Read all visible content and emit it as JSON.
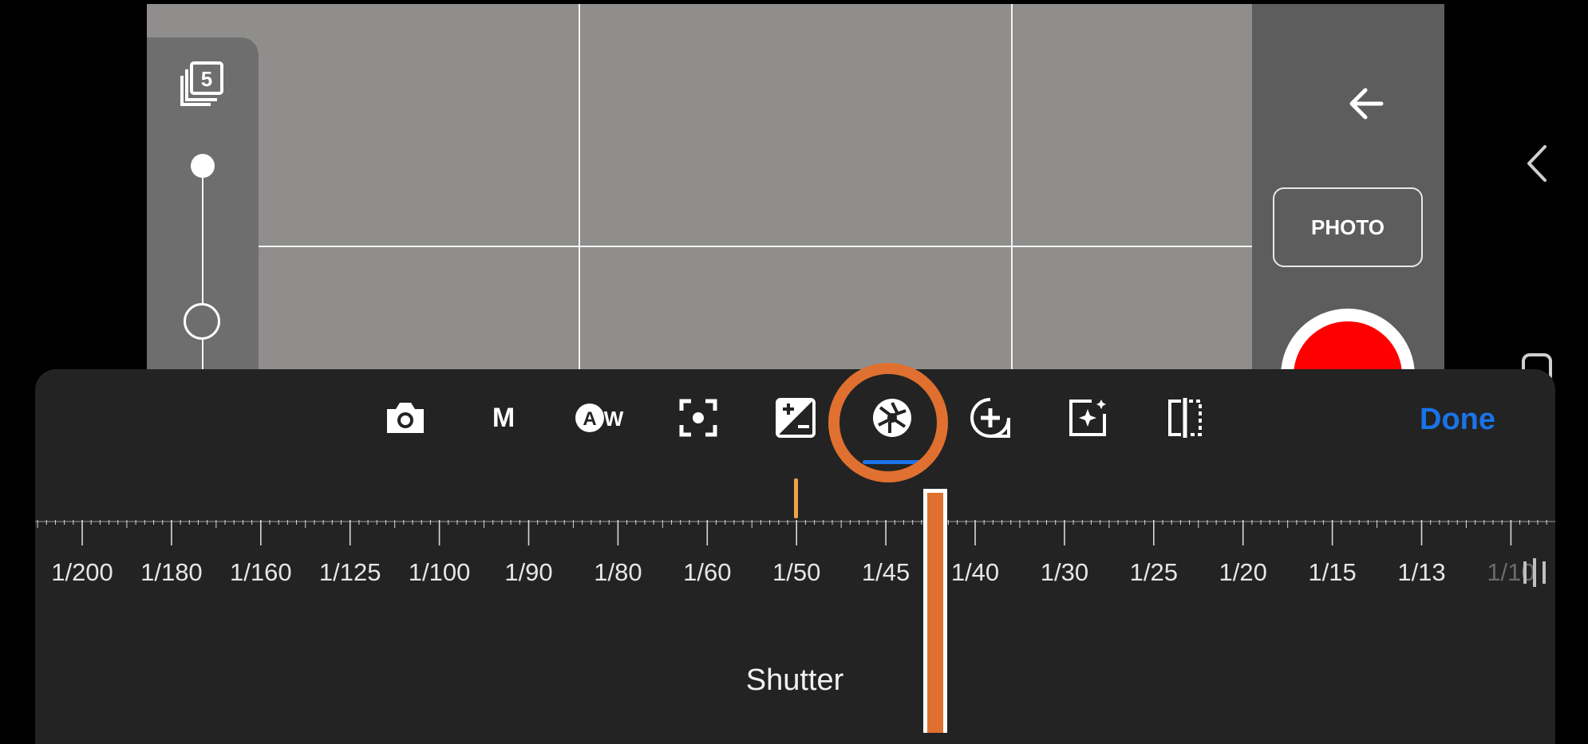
{
  "app": {
    "capture_mode_label": "PHOTO",
    "burst_count": "5"
  },
  "toolbar": {
    "items": [
      {
        "name": "camera-mode-icon",
        "label": ""
      },
      {
        "name": "manual-mode",
        "label": "M"
      },
      {
        "name": "auto-white-balance",
        "label": "AW"
      },
      {
        "name": "focus-icon",
        "label": ""
      },
      {
        "name": "exposure-compensation-icon",
        "label": ""
      },
      {
        "name": "shutter-speed-icon",
        "label": "",
        "selected": true
      },
      {
        "name": "iso-icon",
        "label": ""
      },
      {
        "name": "effects-icon",
        "label": ""
      },
      {
        "name": "split-icon",
        "label": ""
      }
    ],
    "done_label": "Done",
    "accent_color": "#1a73e8"
  },
  "shutter_scale": {
    "ticks": [
      "1/200",
      "1/180",
      "1/160",
      "1/125",
      "1/100",
      "1/90",
      "1/80",
      "1/60",
      "1/50",
      "1/45",
      "1/40",
      "1/30",
      "1/25",
      "1/20",
      "1/15",
      "1/13",
      "1/10"
    ],
    "reference_marker": "1/50",
    "selected_value": "between 1/45 and 1/40",
    "marker_color": "#f0a24a"
  },
  "labels": {
    "shutter": "Shutter"
  },
  "annotation": {
    "highlight_color": "#e07030"
  },
  "record_button_color": "#ff0000"
}
